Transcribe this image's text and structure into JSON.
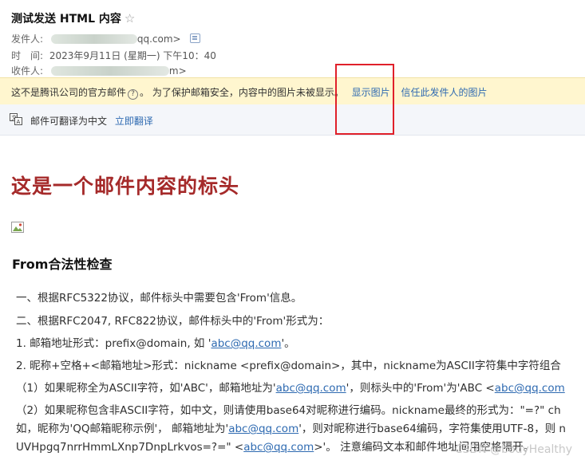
{
  "header": {
    "subject": "测试发送 HTML 内容",
    "star_icon": "☆",
    "from_label": "发件人:",
    "from_value_suffix": "qq.com>",
    "time_label": "时　间:",
    "time_value": "2023年9月11日 (星期一) 下午10：40",
    "to_label": "收件人:",
    "to_value_suffix": "m>"
  },
  "warning": {
    "text": "这不是腾讯公司的官方邮件",
    "qmark": "?",
    "text2": "。 为了保护邮箱安全，内容中的图片未被显示。",
    "show_images": "显示图片",
    "trust_sender": "信任此发件人的图片"
  },
  "translate": {
    "text": "邮件可翻译为中文",
    "action": "立即翻译"
  },
  "content": {
    "heading": "这是一个邮件内容的标头",
    "subheading": "From合法性检查",
    "p1": "一、根据RFC5322协议，邮件标头中需要包含'From'信息。",
    "p2": "二、根据RFC2047, RFC822协议，邮件标头中的'From'形式为：",
    "p3_pre": "1. 邮箱地址形式：prefix@domain, 如 '",
    "p3_link": "abc@qq.com",
    "p3_post": "'。",
    "p4": "2. 昵称+空格+<邮箱地址>形式：nickname <prefix@domain>，其中，nickname为ASCII字符集中字符组合",
    "p5_pre": "（1）如果昵称全为ASCII字符，如'ABC'，邮箱地址为'",
    "p5_link": "abc@qq.com",
    "p5_mid": "'，则标头中的'From'为'ABC <",
    "p5_link2": "abc@qq.com",
    "p6": "（2）如果昵称包含非ASCII字符，如中文，则请使用base64对昵称进行编码。nickname最终的形式为：\"=?\" ch",
    "p7_pre": "如，昵称为'QQ邮箱昵称示例'， 邮箱地址为'",
    "p7_link": "abc@qq.com",
    "p7_post": "'，则对昵称进行base64编码，字符集使用UTF-8，则 n",
    "p8_pre": "UVHpgq7nrrHmmLXnp7DnpLrkvos=?=\" <",
    "p8_link": "abc@qq.com",
    "p8_post": ">'。 注意编码文本和邮件地址间用空格隔开。"
  },
  "watermark": "CSDN @bodyHealthy",
  "colors": {
    "heading": "#a52a2a",
    "link": "#2e6ab1",
    "warning_bg": "#fff6cf",
    "highlight": "#e0202a"
  }
}
